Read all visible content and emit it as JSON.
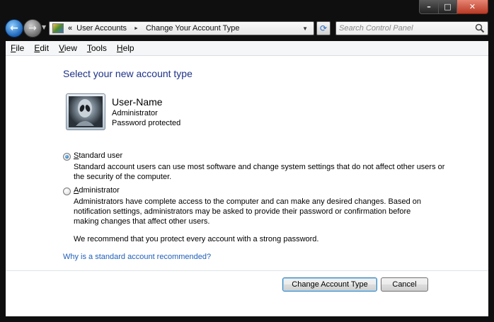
{
  "window": {
    "caption_buttons": {
      "minimize": "–",
      "maximize": "□",
      "close": "✕"
    }
  },
  "navbar": {
    "back_glyph": "←",
    "forward_glyph": "→",
    "breadcrumb": [
      "User Accounts",
      "Change Your Account Type"
    ],
    "breadcrumb_prefix": "«",
    "separator": "►",
    "search_placeholder": "Search Control Panel"
  },
  "menu": {
    "items": [
      {
        "label": "File",
        "accel": "F",
        "rest": "ile"
      },
      {
        "label": "Edit",
        "accel": "E",
        "rest": "dit"
      },
      {
        "label": "View",
        "accel": "V",
        "rest": "iew"
      },
      {
        "label": "Tools",
        "accel": "T",
        "rest": "ools"
      },
      {
        "label": "Help",
        "accel": "H",
        "rest": "elp"
      }
    ]
  },
  "page": {
    "title": "Select your new account type",
    "user": {
      "name": "User-Name",
      "role": "Administrator",
      "status": "Password protected"
    },
    "options": [
      {
        "label": "Standard user",
        "accel": "S",
        "rest": "tandard user",
        "checked": true,
        "description": "Standard account users can use most software and change system settings that do not affect other users or\nthe security of the computer."
      },
      {
        "label": "Administrator",
        "accel": "A",
        "rest": "dministrator",
        "checked": false,
        "description": "Administrators have complete access to the computer and can make any desired changes. Based on\nnotification settings, administrators may be asked to provide their password or confirmation before\nmaking changes that affect other users."
      }
    ],
    "recommendation": "We recommend that you protect every account with a strong password.",
    "link": "Why is a standard account recommended?"
  },
  "footer": {
    "primary_button": "Change Account Type",
    "cancel_button": "Cancel"
  },
  "colors": {
    "title": "#1e3287",
    "link": "#1f5fb8",
    "close_button": "#c8472f"
  }
}
